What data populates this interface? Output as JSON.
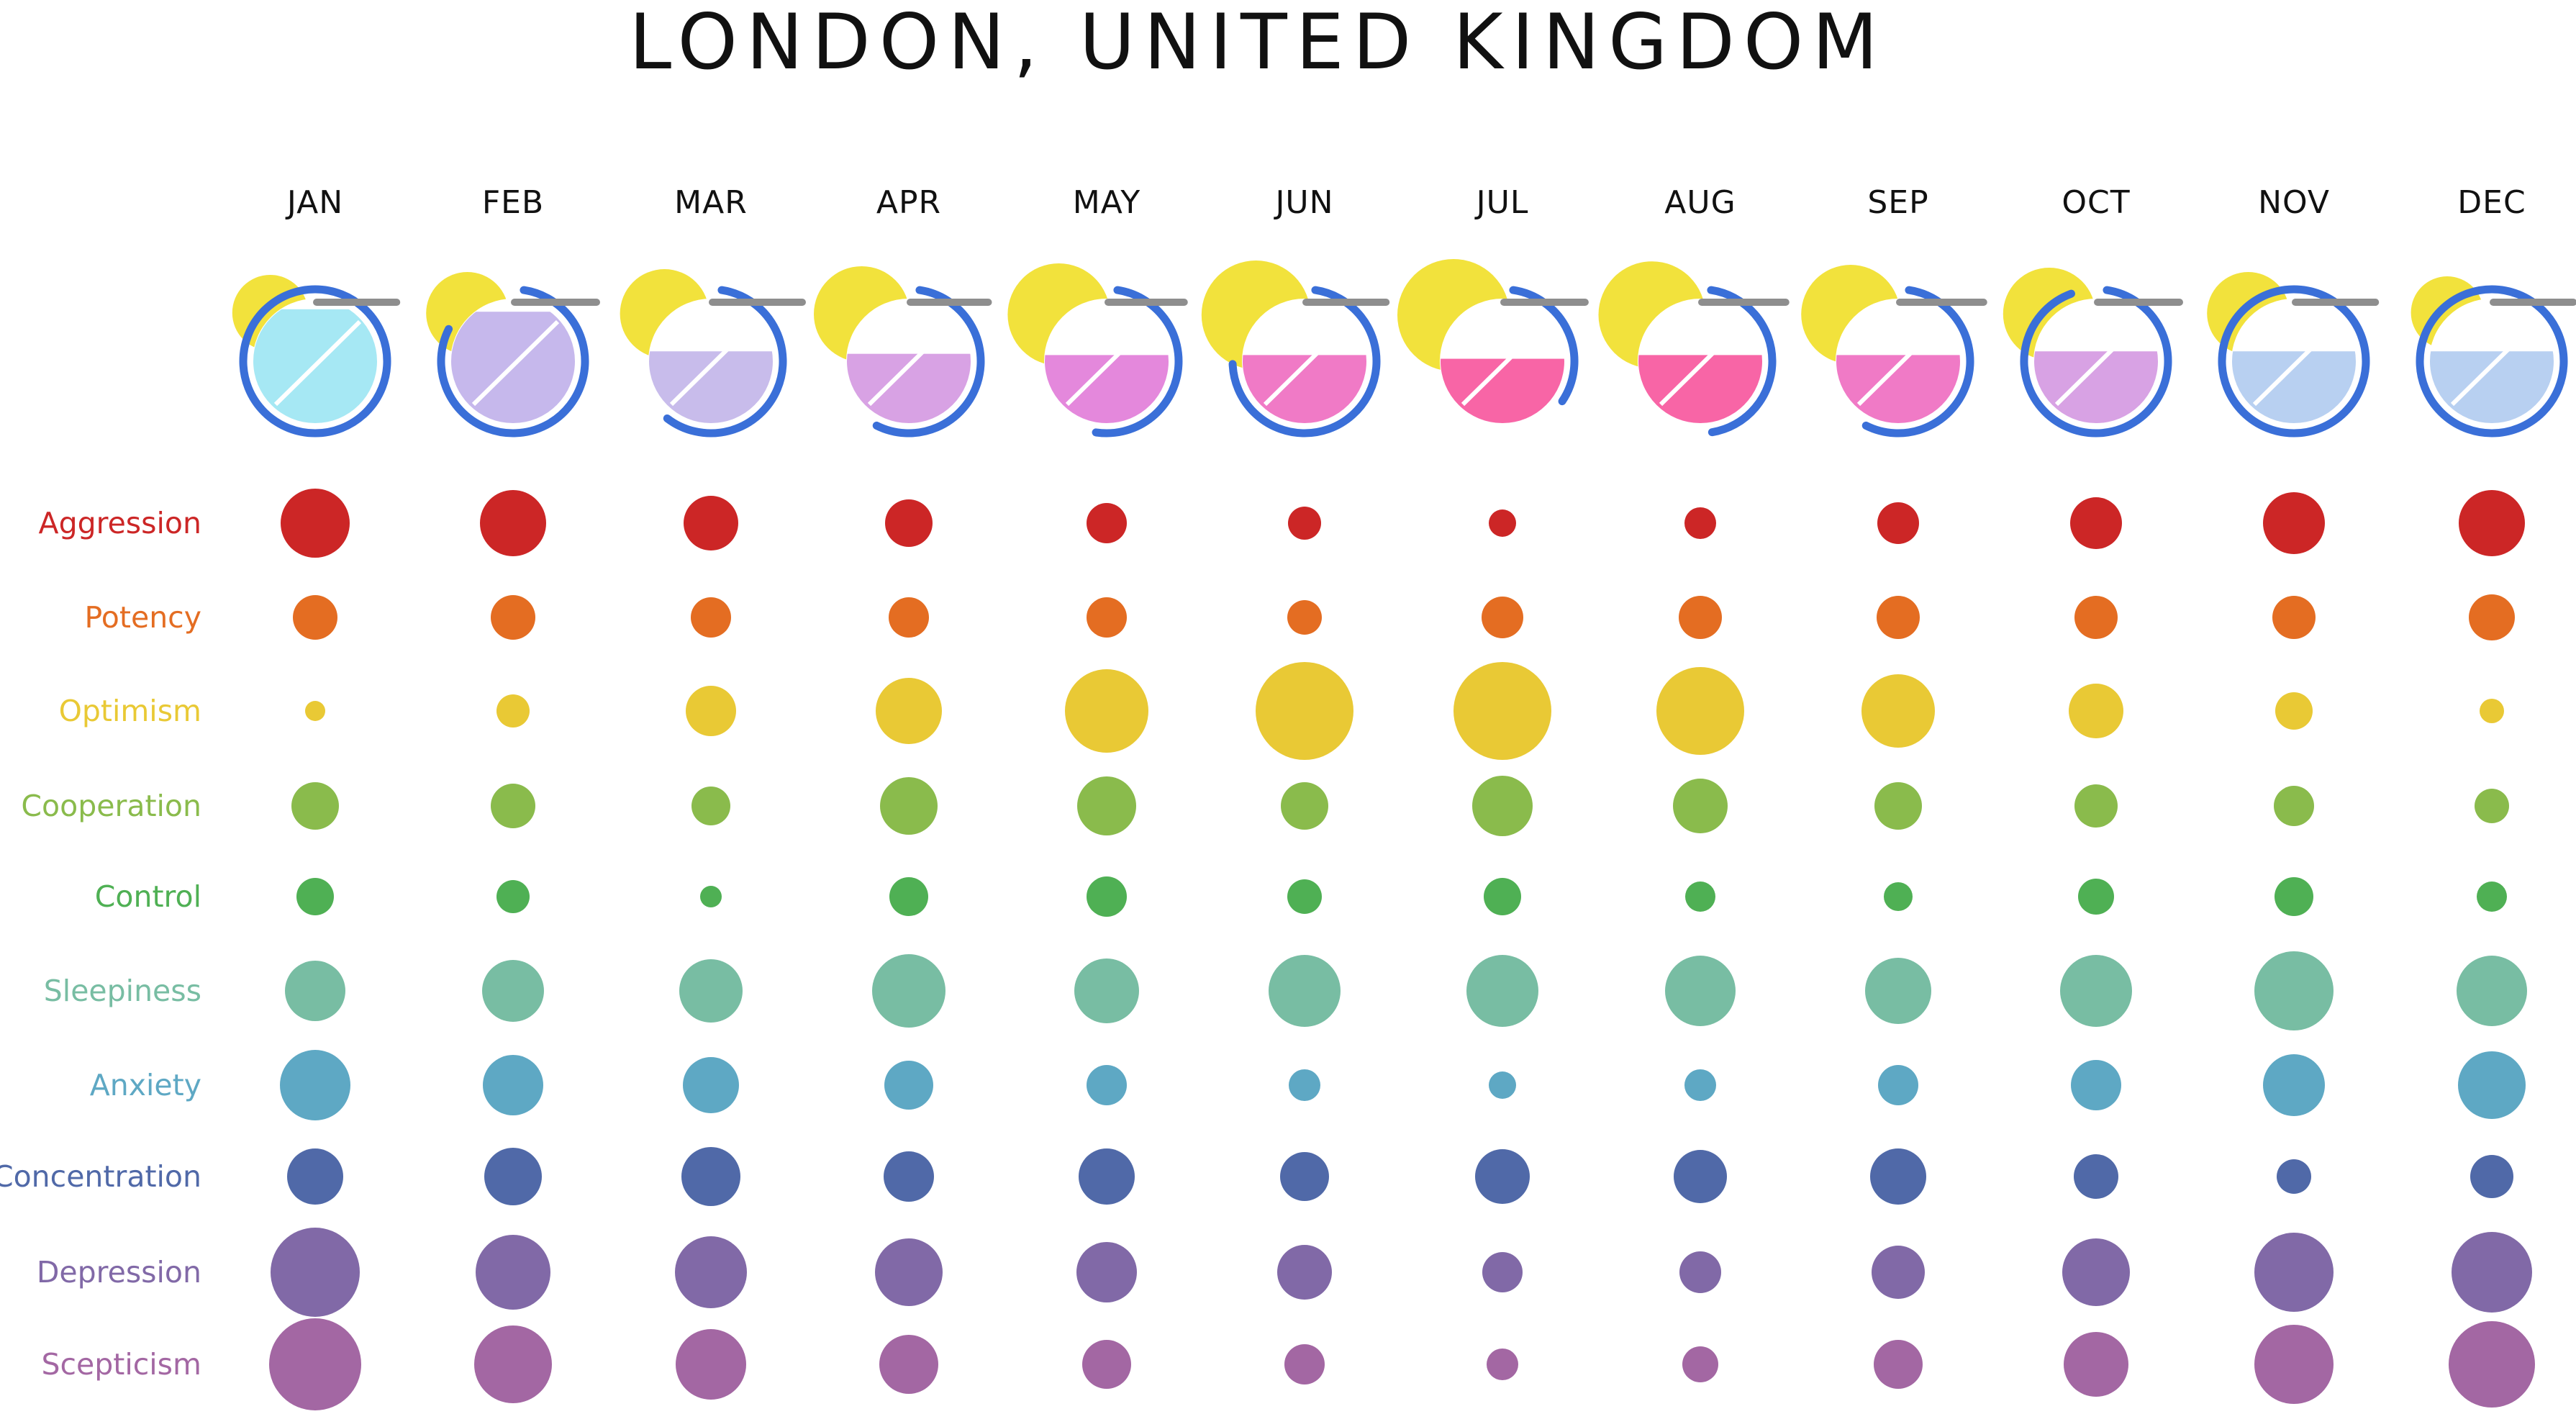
{
  "title": "LONDON, UNITED KINGDOM",
  "chart_data": {
    "type": "bubble-matrix",
    "title": "LONDON, UNITED KINGDOM",
    "months": [
      "JAN",
      "FEB",
      "MAR",
      "APR",
      "MAY",
      "JUN",
      "JUL",
      "AUG",
      "SEP",
      "OCT",
      "NOV",
      "DEC"
    ],
    "header_glyphs": [
      {
        "month": "JAN",
        "sun": 0.45,
        "fill": 0.92,
        "fill_color": "#a6e8f4",
        "arc": 1.0,
        "bar": 0.75
      },
      {
        "month": "FEB",
        "sun": 0.55,
        "fill": 0.9,
        "fill_color": "#c6b8ec",
        "arc": 0.8,
        "bar": 0.8
      },
      {
        "month": "MAR",
        "sun": 0.65,
        "fill": 0.58,
        "fill_color": "#c8bceb",
        "arc": 0.58,
        "bar": 1.0
      },
      {
        "month": "APR",
        "sun": 0.75,
        "fill": 0.56,
        "fill_color": "#d8a2e4",
        "arc": 0.55,
        "bar": 0.7
      },
      {
        "month": "MAY",
        "sun": 0.85,
        "fill": 0.55,
        "fill_color": "#e488dc",
        "arc": 0.5,
        "bar": 0.65
      },
      {
        "month": "JUN",
        "sun": 0.95,
        "fill": 0.55,
        "fill_color": "#f07ac6",
        "arc": 0.72,
        "bar": 0.75
      },
      {
        "month": "JUL",
        "sun": 1.0,
        "fill": 0.52,
        "fill_color": "#f865a6",
        "arc": 0.32,
        "bar": 0.78
      },
      {
        "month": "AUG",
        "sun": 0.92,
        "fill": 0.55,
        "fill_color": "#f865a6",
        "arc": 0.45,
        "bar": 0.85
      },
      {
        "month": "SEP",
        "sun": 0.8,
        "fill": 0.55,
        "fill_color": "#f07ac6",
        "arc": 0.55,
        "bar": 0.85
      },
      {
        "month": "OCT",
        "sun": 0.7,
        "fill": 0.58,
        "fill_color": "#d8a2e4",
        "arc": 0.92,
        "bar": 0.8
      },
      {
        "month": "NOV",
        "sun": 0.55,
        "fill": 0.58,
        "fill_color": "#b8d0f1",
        "arc": 1.0,
        "bar": 0.75
      },
      {
        "month": "DEC",
        "sun": 0.4,
        "fill": 0.58,
        "fill_color": "#b8d0f1",
        "arc": 1.0,
        "bar": 0.75
      }
    ],
    "series": [
      {
        "name": "Aggression",
        "color": "#cc2626",
        "values": [
          48,
          46,
          38,
          33,
          28,
          23,
          19,
          22,
          29,
          36,
          43,
          46
        ]
      },
      {
        "name": "Potency",
        "color": "#e46d22",
        "values": [
          31,
          31,
          28,
          28,
          28,
          24,
          29,
          30,
          30,
          30,
          30,
          32
        ]
      },
      {
        "name": "Optimism",
        "color": "#e9c935",
        "values": [
          14,
          23,
          35,
          46,
          58,
          68,
          68,
          61,
          51,
          38,
          26,
          17
        ]
      },
      {
        "name": "Cooperation",
        "color": "#8abb4c",
        "values": [
          33,
          31,
          27,
          40,
          41,
          33,
          42,
          38,
          33,
          30,
          28,
          24
        ]
      },
      {
        "name": "Control",
        "color": "#4fb054",
        "values": [
          26,
          23,
          15,
          27,
          28,
          24,
          26,
          21,
          20,
          25,
          27,
          21
        ]
      },
      {
        "name": "Sleepiness",
        "color": "#78bda3",
        "values": [
          42,
          43,
          44,
          51,
          45,
          50,
          50,
          49,
          46,
          50,
          55,
          49
        ]
      },
      {
        "name": "Anxiety",
        "color": "#5ea8c4",
        "values": [
          49,
          42,
          39,
          34,
          28,
          22,
          19,
          22,
          28,
          35,
          43,
          47
        ]
      },
      {
        "name": "Concentration",
        "color": "#5069a8",
        "values": [
          39,
          40,
          41,
          35,
          39,
          34,
          38,
          37,
          39,
          31,
          24,
          30
        ]
      },
      {
        "name": "Depression",
        "color": "#8169a7",
        "values": [
          62,
          52,
          50,
          47,
          42,
          38,
          28,
          29,
          37,
          47,
          55,
          56
        ]
      },
      {
        "name": "Scepticism",
        "color": "#a367a3",
        "values": [
          64,
          54,
          49,
          41,
          34,
          28,
          22,
          25,
          34,
          45,
          55,
          60
        ]
      }
    ]
  }
}
